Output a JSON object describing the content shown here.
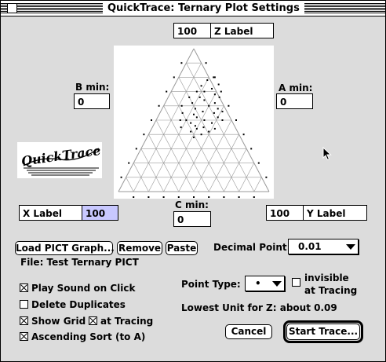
{
  "window": {
    "title": "QuickTrace: Ternary Plot Settings"
  },
  "fields": {
    "z_value": "100",
    "z_label": "Z Label",
    "b_min_label": "B min:",
    "b_min": "0",
    "a_min_label": "A min:",
    "a_min": "0",
    "c_min_label": "C min:",
    "c_min": "0",
    "x_label": "X Label",
    "x_value": "100",
    "y_value": "100",
    "y_label": "Y Label"
  },
  "logo": {
    "text": "QuickTrace"
  },
  "buttons": {
    "load_pict": "Load PICT Graph...",
    "remove": "Remove",
    "paste": "Paste",
    "cancel": "Cancel",
    "start_trace": "Start Trace..."
  },
  "file_info": "File: Test Ternary PICT",
  "decimal_point": {
    "label": "Decimal Point:",
    "value": "0.01"
  },
  "point_type": {
    "label": "Point Type:",
    "value": "•"
  },
  "invisible_tracing": {
    "line1": "invisible",
    "line2": "at Tracing",
    "checked": false
  },
  "options": {
    "play_sound": {
      "label": "Play Sound on Click",
      "checked": true
    },
    "delete_duplicates": {
      "label": "Delete Duplicates",
      "checked": false
    },
    "show_grid": {
      "label": "Show Grid",
      "checked": true
    },
    "grid_at_tracing": {
      "label": "at Tracing",
      "checked": true
    },
    "ascending_sort": {
      "label": "Ascending Sort (to A)",
      "checked": true
    }
  },
  "lowest_unit": "Lowest Unit for Z: about 0.09",
  "ternary": {
    "points": [
      [
        0.15,
        0.55
      ],
      [
        0.18,
        0.62
      ],
      [
        0.2,
        0.5
      ],
      [
        0.22,
        0.58
      ],
      [
        0.25,
        0.64
      ],
      [
        0.19,
        0.45
      ],
      [
        0.24,
        0.48
      ],
      [
        0.28,
        0.56
      ],
      [
        0.3,
        0.6
      ],
      [
        0.27,
        0.42
      ],
      [
        0.32,
        0.5
      ],
      [
        0.34,
        0.45
      ],
      [
        0.36,
        0.55
      ],
      [
        0.22,
        0.7
      ],
      [
        0.26,
        0.72
      ],
      [
        0.3,
        0.68
      ],
      [
        0.18,
        0.74
      ],
      [
        0.14,
        0.66
      ],
      [
        0.38,
        0.48
      ],
      [
        0.4,
        0.52
      ],
      [
        0.35,
        0.4
      ],
      [
        0.31,
        0.38
      ],
      [
        0.42,
        0.44
      ],
      [
        0.2,
        0.78
      ],
      [
        0.24,
        0.8
      ],
      [
        0.29,
        0.75
      ],
      [
        0.33,
        0.62
      ],
      [
        0.37,
        0.58
      ],
      [
        0.16,
        0.5
      ],
      [
        0.12,
        0.6
      ],
      [
        0.21,
        0.66
      ],
      [
        0.44,
        0.5
      ],
      [
        0.39,
        0.42
      ],
      [
        0.26,
        0.52
      ],
      [
        0.28,
        0.46
      ],
      [
        0.23,
        0.54
      ],
      [
        0.17,
        0.7
      ],
      [
        0.41,
        0.56
      ],
      [
        0.34,
        0.66
      ],
      [
        0.3,
        0.44
      ]
    ]
  }
}
